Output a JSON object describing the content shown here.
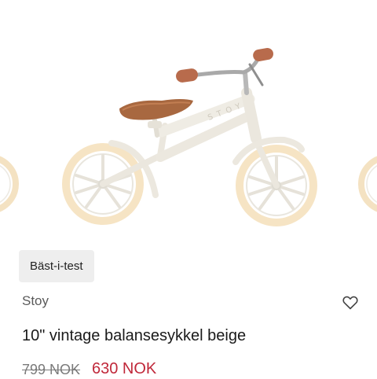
{
  "product": {
    "badge": "Bäst-i-test",
    "brand": "Stoy",
    "title": "10\" vintage balansesykkel beige",
    "old_price": "799 NOK",
    "new_price": "630 NOK",
    "frame_lettering": "STOY"
  },
  "colors": {
    "sale_price": "#c0283a",
    "frame": "#efece4",
    "tire": "#f6e4c4",
    "saddle": "#a86840",
    "grip": "#b86b4c"
  },
  "icons": {
    "wishlist": "heart-outline-icon"
  }
}
